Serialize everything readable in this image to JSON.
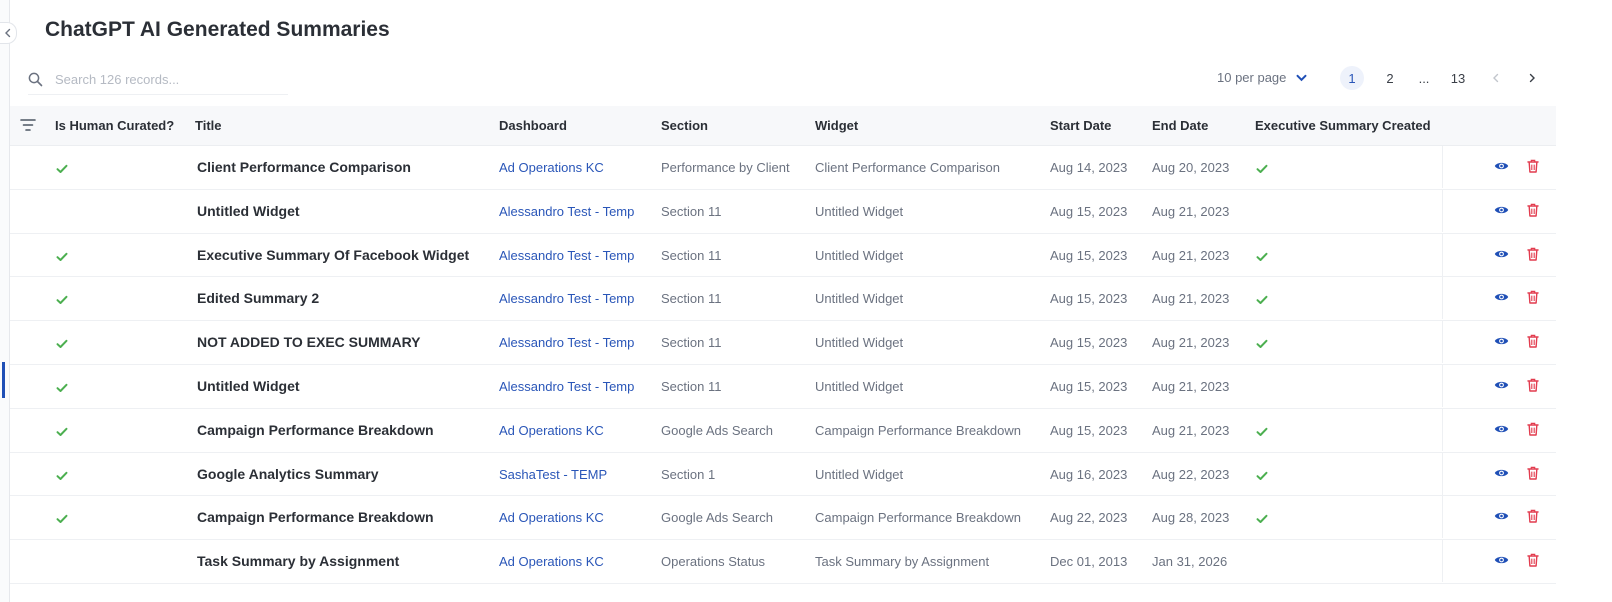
{
  "page": {
    "title": "ChatGPT AI Generated Summaries"
  },
  "search": {
    "placeholder": "Search 126 records..."
  },
  "pagination": {
    "per_page_label": "10 per page",
    "pages": [
      "1",
      "2",
      "...",
      "13"
    ],
    "current_page": "1"
  },
  "columns": {
    "human_curated": "Is Human Curated?",
    "title": "Title",
    "dashboard": "Dashboard",
    "section": "Section",
    "widget": "Widget",
    "start_date": "Start Date",
    "end_date": "End Date",
    "exec_summary": "Executive Summary Created"
  },
  "colors": {
    "accent": "#2a56b8",
    "check": "#4caf50",
    "delete": "#e23b4e",
    "eye": "#1f4fb6"
  },
  "rows": [
    {
      "human_curated": true,
      "title": "Client Performance Comparison",
      "dashboard": "Ad Operations KC",
      "section": "Performance by Client",
      "widget": "Client Performance Comparison",
      "start_date": "Aug 14, 2023",
      "end_date": "Aug 20, 2023",
      "exec_summary": true
    },
    {
      "human_curated": false,
      "title": "Untitled Widget",
      "dashboard": "Alessandro Test - Temp",
      "section": "Section 11",
      "widget": "Untitled Widget",
      "start_date": "Aug 15, 2023",
      "end_date": "Aug 21, 2023",
      "exec_summary": false
    },
    {
      "human_curated": true,
      "title": "Executive Summary Of Facebook Widget",
      "dashboard": "Alessandro Test - Temp",
      "section": "Section 11",
      "widget": "Untitled Widget",
      "start_date": "Aug 15, 2023",
      "end_date": "Aug 21, 2023",
      "exec_summary": true
    },
    {
      "human_curated": true,
      "title": "Edited Summary 2",
      "dashboard": "Alessandro Test - Temp",
      "section": "Section 11",
      "widget": "Untitled Widget",
      "start_date": "Aug 15, 2023",
      "end_date": "Aug 21, 2023",
      "exec_summary": true
    },
    {
      "human_curated": true,
      "title": "NOT ADDED TO EXEC SUMMARY",
      "dashboard": "Alessandro Test - Temp",
      "section": "Section 11",
      "widget": "Untitled Widget",
      "start_date": "Aug 15, 2023",
      "end_date": "Aug 21, 2023",
      "exec_summary": true
    },
    {
      "human_curated": true,
      "title": "Untitled Widget",
      "dashboard": "Alessandro Test - Temp",
      "section": "Section 11",
      "widget": "Untitled Widget",
      "start_date": "Aug 15, 2023",
      "end_date": "Aug 21, 2023",
      "exec_summary": false
    },
    {
      "human_curated": true,
      "title": "Campaign Performance Breakdown",
      "dashboard": "Ad Operations KC",
      "section": "Google Ads Search",
      "widget": "Campaign Performance Breakdown",
      "start_date": "Aug 15, 2023",
      "end_date": "Aug 21, 2023",
      "exec_summary": true
    },
    {
      "human_curated": true,
      "title": "Google Analytics Summary",
      "dashboard": "SashaTest - TEMP",
      "section": "Section 1",
      "widget": "Untitled Widget",
      "start_date": "Aug 16, 2023",
      "end_date": "Aug 22, 2023",
      "exec_summary": true
    },
    {
      "human_curated": true,
      "title": "Campaign Performance Breakdown",
      "dashboard": "Ad Operations KC",
      "section": "Google Ads Search",
      "widget": "Campaign Performance Breakdown",
      "start_date": "Aug 22, 2023",
      "end_date": "Aug 28, 2023",
      "exec_summary": true
    },
    {
      "human_curated": false,
      "title": "Task Summary by Assignment",
      "dashboard": "Ad Operations KC",
      "section": "Operations Status",
      "widget": "Task Summary by Assignment",
      "start_date": "Dec 01, 2013",
      "end_date": "Jan 31, 2026",
      "exec_summary": false
    }
  ]
}
